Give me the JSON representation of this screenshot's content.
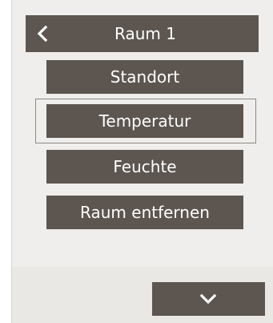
{
  "header": {
    "title": "Raum 1",
    "back_icon": "chevron-left-icon"
  },
  "menu": {
    "items": [
      {
        "label": "Standort"
      },
      {
        "label": "Temperatur",
        "selected": true
      },
      {
        "label": "Feuchte"
      },
      {
        "label": "Raum entfernen"
      }
    ]
  },
  "footer": {
    "scroll_icon": "chevron-down-icon"
  },
  "colors": {
    "button": "#5d5650",
    "panel": "#efeeec",
    "text": "#ffffff"
  }
}
